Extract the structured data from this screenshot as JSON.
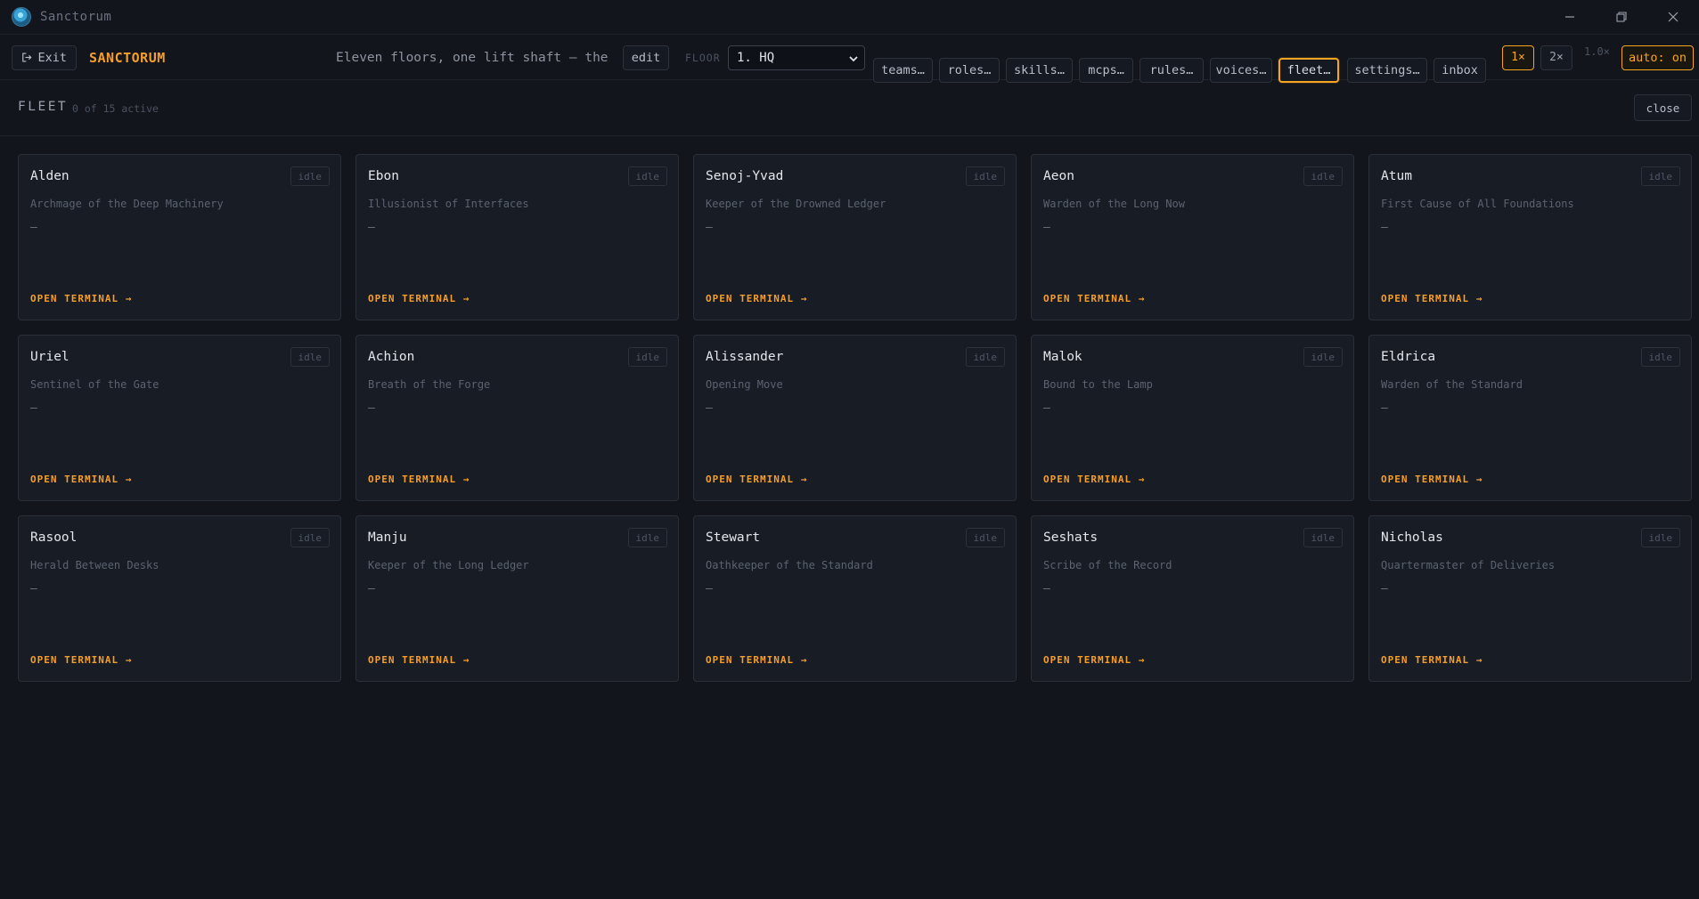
{
  "window": {
    "title": "Sanctorum",
    "controls": [
      "minimize",
      "restore",
      "close"
    ]
  },
  "toolbar": {
    "exit_label": "Exit",
    "brand": "SANCTORUM",
    "tagline": "Eleven floors, one lift shaft — the p",
    "edit_label": "edit",
    "floor_label": "FLOOR",
    "floor_value": "1. HQ",
    "nav": [
      {
        "label": "teams…"
      },
      {
        "label": "roles…"
      },
      {
        "label": "skills…"
      },
      {
        "label": "mcps…"
      },
      {
        "label": "rules…"
      },
      {
        "label": "voices…"
      },
      {
        "label": "fleet…",
        "active": true
      },
      {
        "label": "settings…"
      },
      {
        "label": "inbox"
      }
    ],
    "speed_1x": "1×",
    "speed_2x": "2×",
    "speed_value": "1.0×",
    "auto_label": "auto: on",
    "accent": "#f5a524"
  },
  "fleet": {
    "title": "FLEET",
    "count": "0 of 15 active",
    "close_label": "close",
    "link_label": "OPEN TERMINAL →",
    "agents": [
      {
        "name": "Alden",
        "role": "Archmage of the Deep Machinery",
        "status": "idle",
        "detail": "—"
      },
      {
        "name": "Ebon",
        "role": "Illusionist of Interfaces",
        "status": "idle",
        "detail": "—"
      },
      {
        "name": "Senoj-Yvad",
        "role": "Keeper of the Drowned Ledger",
        "status": "idle",
        "detail": "—"
      },
      {
        "name": "Aeon",
        "role": "Warden of the Long Now",
        "status": "idle",
        "detail": "—"
      },
      {
        "name": "Atum",
        "role": "First Cause of All Foundations",
        "status": "idle",
        "detail": "—"
      },
      {
        "name": "Uriel",
        "role": "Sentinel of the Gate",
        "status": "idle",
        "detail": "—"
      },
      {
        "name": "Achion",
        "role": "Breath of the Forge",
        "status": "idle",
        "detail": "—"
      },
      {
        "name": "Alissander",
        "role": "Opening Move",
        "status": "idle",
        "detail": "—"
      },
      {
        "name": "Malok",
        "role": "Bound to the Lamp",
        "status": "idle",
        "detail": "—"
      },
      {
        "name": "Eldrica",
        "role": "Warden of the Standard",
        "status": "idle",
        "detail": "—"
      },
      {
        "name": "Rasool",
        "role": "Herald Between Desks",
        "status": "idle",
        "detail": "—"
      },
      {
        "name": "Manju",
        "role": "Keeper of the Long Ledger",
        "status": "idle",
        "detail": "—"
      },
      {
        "name": "Stewart",
        "role": "Oathkeeper of the Standard",
        "status": "idle",
        "detail": "—"
      },
      {
        "name": "Seshats",
        "role": "Scribe of the Record",
        "status": "idle",
        "detail": "—"
      },
      {
        "name": "Nicholas",
        "role": "Quartermaster of Deliveries",
        "status": "idle",
        "detail": "—"
      }
    ]
  }
}
